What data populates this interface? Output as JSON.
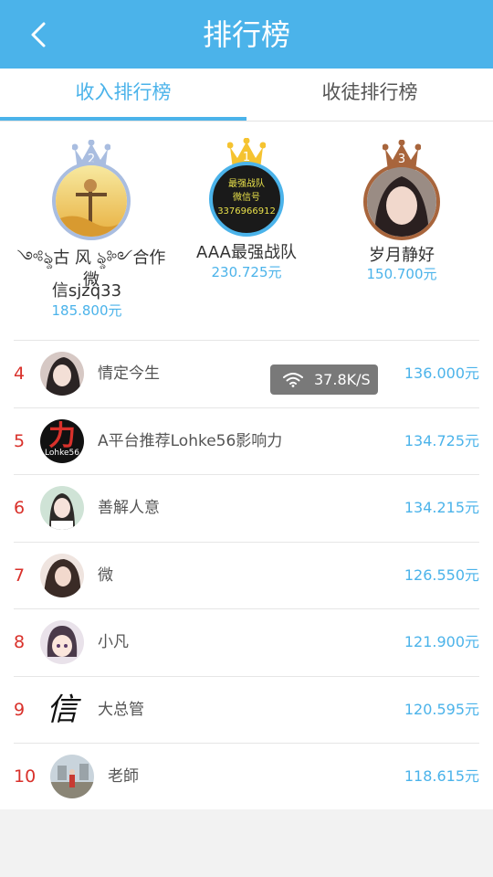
{
  "header": {
    "title": "排行榜",
    "back_icon": "chevron-left-icon"
  },
  "tabs": [
    {
      "label": "收入排行榜",
      "active": true
    },
    {
      "label": "收徒排行榜",
      "active": false
    }
  ],
  "podium": [
    {
      "rank": "2",
      "name_line1": "༺ৡ古 风 ৡ༻合作微",
      "name_line2": "信sjzq33",
      "amount": "185.800元",
      "crown_color": "#a9bde0"
    },
    {
      "rank": "1",
      "name_line1": "AAA最强战队",
      "amount": "230.725元",
      "crown_color": "#f5c330",
      "avatar_text": [
        "最强战队",
        "微信号",
        "3376966912"
      ]
    },
    {
      "rank": "3",
      "name_line1": "岁月静好",
      "amount": "150.700元",
      "crown_color": "#a8653c"
    }
  ],
  "list": [
    {
      "rank": "4",
      "name": "情定今生",
      "amount": "136.000元"
    },
    {
      "rank": "5",
      "name": "A平台推荐Lohke56影响力",
      "amount": "134.725元",
      "avatar_text": [
        "力",
        "Lohke56"
      ]
    },
    {
      "rank": "6",
      "name": "善解人意",
      "amount": "134.215元"
    },
    {
      "rank": "7",
      "name": "微",
      "amount": "126.550元"
    },
    {
      "rank": "8",
      "name": "小凡",
      "amount": "121.900元"
    },
    {
      "rank": "9",
      "name": "大总管",
      "amount": "120.595元",
      "avatar_text": [
        "信"
      ]
    },
    {
      "rank": "10",
      "name": "老師",
      "amount": "118.615元"
    }
  ],
  "toast": {
    "speed": "37.8K/S",
    "icon": "wifi-icon"
  },
  "colors": {
    "accent": "#4bb3ea",
    "rank": "#d9312b"
  }
}
